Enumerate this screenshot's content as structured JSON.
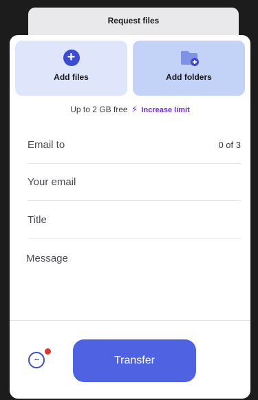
{
  "header": {
    "title": "Request files"
  },
  "tiles": {
    "add_files": {
      "label": "Add files",
      "icon": "plus-circle-icon"
    },
    "add_folders": {
      "label": "Add folders",
      "icon": "folder-plus-icon"
    }
  },
  "limit": {
    "text": "Up to 2 GB free",
    "bolt_icon": "⚡",
    "link": "Increase limit"
  },
  "form": {
    "email_to": {
      "placeholder": "Email to",
      "count": "0 of 3"
    },
    "your_email": {
      "placeholder": "Your email"
    },
    "title": {
      "placeholder": "Title"
    },
    "message": {
      "placeholder": "Message"
    }
  },
  "footer": {
    "transfer_label": "Transfer",
    "chat_icon": "chat-dots-icon"
  },
  "colors": {
    "accent": "#4f63e2",
    "accent_dark": "#3d4bd3",
    "link": "#6b2df0",
    "notification": "#e0352b"
  }
}
